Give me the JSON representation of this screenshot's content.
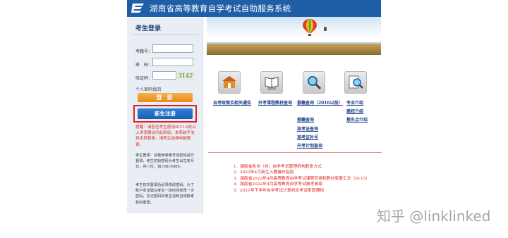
{
  "header": {
    "title": "湖南省高等教育自学考试自助服务系统",
    "brand_color": "#1f5fa8"
  },
  "login": {
    "heading": "考生登录",
    "exam_no_label": "考籍号：",
    "exam_no_value": "",
    "password_label": "密　码：",
    "password_value": "",
    "captcha_label": "验证码：",
    "captcha_value": "",
    "captcha_text": "3142",
    "forgot_label": "个人密码找回",
    "login_button": "登 录",
    "register_button": "新生注册",
    "warning": "提醒：请各位考生使用IE11.0及以上浏览器访问此网站，本系统不支持手机登录，请考生选择电脑登录。",
    "notice_1": "考生登录：请使用考籍号加密码进行登录，考生初始密码为考生出生年月日，共八位，如19810809。",
    "notice_2": "考生初次登录后必须修改密码，为了账户安全建议考生一段时间修改一次密码，忘记密码的考生请到当地报考机构重置。"
  },
  "quick_links": {
    "col1": [
      "自考政策及相关通告"
    ],
    "col2": [
      "开考课程教材查询"
    ],
    "col3": [
      "报籍查询（2016以前）",
      "报籍查询",
      "准考证查询",
      "准考证补号",
      "开考计划查询"
    ],
    "col4": [
      "专业介绍",
      "高校介绍",
      "报名点介绍"
    ],
    "icons": [
      "house-icon",
      "book-icon",
      "magnifier-icon",
      "magnifier-document-icon"
    ]
  },
  "news": {
    "items": [
      "湖南省各市（州）自学考试管理机构联系方式",
      "2022年4月新生入籍操作指南",
      "湖南省2022年4月高等教育自学考试课程安排和教材变更汇总（0115）",
      "湖南省2022年4月高等教育自学考试报考简章",
      "2021年下半年自学考试计算机化考试家庭通知"
    ],
    "color": "#e02020"
  },
  "watermark": "知乎 @linklinked"
}
